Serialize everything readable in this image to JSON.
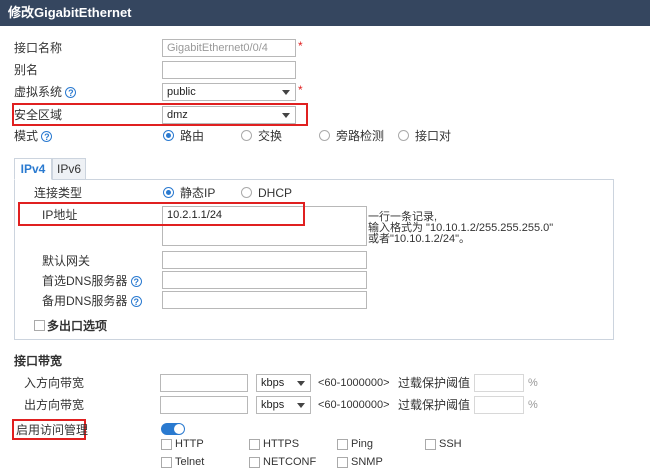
{
  "dialog": {
    "title": "修改GigabitEthernet"
  },
  "form": {
    "interface_name": {
      "label": "接口名称",
      "value": "GigabitEthernet0/0/4"
    },
    "alias": {
      "label": "别名",
      "value": ""
    },
    "virtual_system": {
      "label": "虚拟系统",
      "value": "public"
    },
    "security_zone": {
      "label": "安全区域",
      "value": "dmz"
    },
    "mode": {
      "label": "模式",
      "options": [
        "路由",
        "交换",
        "旁路检测",
        "接口对"
      ],
      "selected": "路由"
    },
    "required_mark": "*"
  },
  "tabs": [
    {
      "label": "IPv4"
    },
    {
      "label": "IPv6"
    }
  ],
  "ipv4": {
    "conn_type": {
      "label": "连接类型",
      "options": [
        "静态IP",
        "DHCP"
      ],
      "selected": "静态IP"
    },
    "ip_address": {
      "label": "IP地址",
      "value": "10.2.1.1/24"
    },
    "ip_hint": [
      "一行一条记录,",
      "输入格式为 \"10.10.1.2/255.255.255.0\"",
      "或者\"10.10.1.2/24\"。"
    ],
    "gateway": {
      "label": "默认网关",
      "value": ""
    },
    "dns_primary": {
      "label": "首选DNS服务器",
      "value": ""
    },
    "dns_secondary": {
      "label": "备用DNS服务器",
      "value": ""
    },
    "multi_exit": {
      "label": "多出口选项",
      "checked": false
    }
  },
  "bandwidth": {
    "section_title": "接口带宽",
    "inbound": {
      "label": "入方向带宽",
      "value": "",
      "unit": "kbps",
      "range": "<60-1000000>",
      "overload_label": "过载保护阈值",
      "overload_value": "",
      "percent": "%"
    },
    "outbound": {
      "label": "出方向带宽",
      "value": "",
      "unit": "kbps",
      "range": "<60-1000000>",
      "overload_label": "过载保护阈值",
      "overload_value": "",
      "percent": "%"
    }
  },
  "access": {
    "label": "启用访问管理",
    "enabled": true,
    "services": [
      {
        "label": "HTTP",
        "checked": false
      },
      {
        "label": "HTTPS",
        "checked": false
      },
      {
        "label": "Ping",
        "checked": false
      },
      {
        "label": "SSH",
        "checked": false
      },
      {
        "label": "Telnet",
        "checked": false
      },
      {
        "label": "NETCONF",
        "checked": false
      },
      {
        "label": "SNMP",
        "checked": false
      }
    ]
  },
  "colors": {
    "title_bar": "#35465f",
    "accent": "#2a7ad0",
    "highlight_border": "#e02020"
  },
  "icons": {
    "help": "question-circle-icon",
    "dropdown": "chevron-down-icon"
  },
  "help_glyph": "?"
}
